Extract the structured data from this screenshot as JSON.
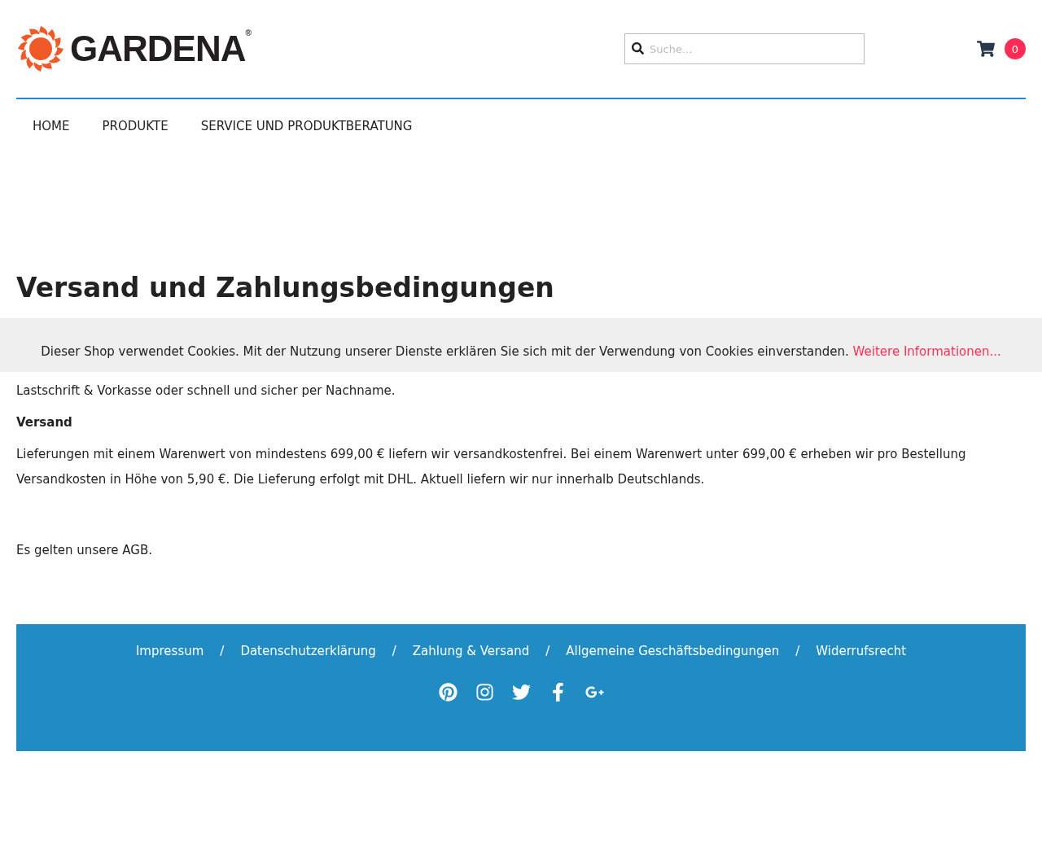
{
  "header": {
    "logo": {
      "text": "GARDENA",
      "mark": "®"
    },
    "search": {
      "placeholder": "Suche..."
    },
    "cart": {
      "count": "0"
    }
  },
  "nav": [
    "HOME",
    "PRODUKTE",
    "SERVICE UND PRODUKTBERATUNG"
  ],
  "page": {
    "title": "Versand und Zahlungsbedingungen"
  },
  "cookie_banner": {
    "text": "Dieser Shop verwendet Cookies. Mit der Nutzung unserer Dienste erklären Sie sich mit der Verwendung von Cookies einverstanden.",
    "link": "Weitere Informationen..."
  },
  "content": [
    {
      "kind": "paragraph",
      "text": "Lastschrift & Vorkasse oder schnell und sicher per Nachname."
    },
    {
      "kind": "heading",
      "text": "Versand"
    },
    {
      "kind": "paragraph",
      "text": "Lieferungen mit einem Warenwert von mindestens 699,00 € liefern wir versandkostenfrei. Bei einem Warenwert unter 699,00 € erheben wir pro Bestellung Versandkosten in Höhe von 5,90 €. Die Lieferung erfolgt mit DHL. Aktuell liefern wir nur innerhalb Deutschlands."
    },
    {
      "kind": "spacer"
    },
    {
      "kind": "paragraph",
      "text": "Es gelten unsere AGB."
    }
  ],
  "footer": {
    "links": [
      "Impressum",
      "Datenschutzerklärung",
      "Zahlung & Versand",
      "Allgemeine Geschäftsbedingungen",
      "Widerrufsrecht"
    ],
    "separator": "/",
    "social": [
      {
        "kind": "pinterest"
      },
      {
        "kind": "instagram"
      },
      {
        "kind": "twitter"
      },
      {
        "kind": "facebook"
      },
      {
        "kind": "googleplus"
      }
    ]
  }
}
